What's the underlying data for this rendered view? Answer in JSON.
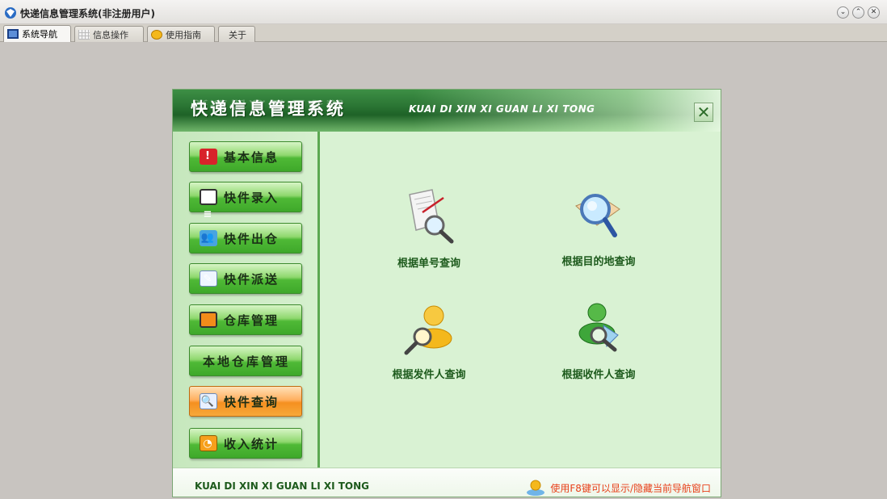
{
  "window": {
    "title": "快递信息管理系统(非注册用户)"
  },
  "tabs": [
    {
      "label": "系统导航",
      "icon": "monitor-icon",
      "active": true
    },
    {
      "label": "信息操作",
      "icon": "grid-icon",
      "active": false
    },
    {
      "label": "使用指南",
      "icon": "clock-icon",
      "active": false
    },
    {
      "label": "关于",
      "icon": "",
      "active": false
    }
  ],
  "panel": {
    "title": "快递信息管理系统",
    "pinyin": "KUAI DI XIN XI GUAN LI XI TONG",
    "close_label": "✕"
  },
  "nav": [
    {
      "label": "基本信息",
      "icon": "alert-icon"
    },
    {
      "label": "快件录入",
      "icon": "contact-card-icon"
    },
    {
      "label": "快件出仓",
      "icon": "people-icon"
    },
    {
      "label": "快件派送",
      "icon": "pen-doc-icon"
    },
    {
      "label": "仓库管理",
      "icon": "monitor-icon"
    },
    {
      "label": "本地仓库管理",
      "icon": ""
    },
    {
      "label": "快件查询",
      "icon": "doc-search-icon",
      "active": true
    },
    {
      "label": "收入统计",
      "icon": "rss-icon"
    }
  ],
  "actions": [
    {
      "label": "根据单号查询",
      "icon": "paper-magnifier-icon"
    },
    {
      "label": "根据目的地查询",
      "icon": "map-magnifier-icon"
    },
    {
      "label": "根据发件人查询",
      "icon": "user-magnifier-icon"
    },
    {
      "label": "根据收件人查询",
      "icon": "group-magnifier-icon"
    }
  ],
  "footer": {
    "pinyin": "KUAI DI XIN XI GUAN LI XI TONG",
    "tip": "使用F8键可以显示/隐藏当前导航窗口"
  }
}
